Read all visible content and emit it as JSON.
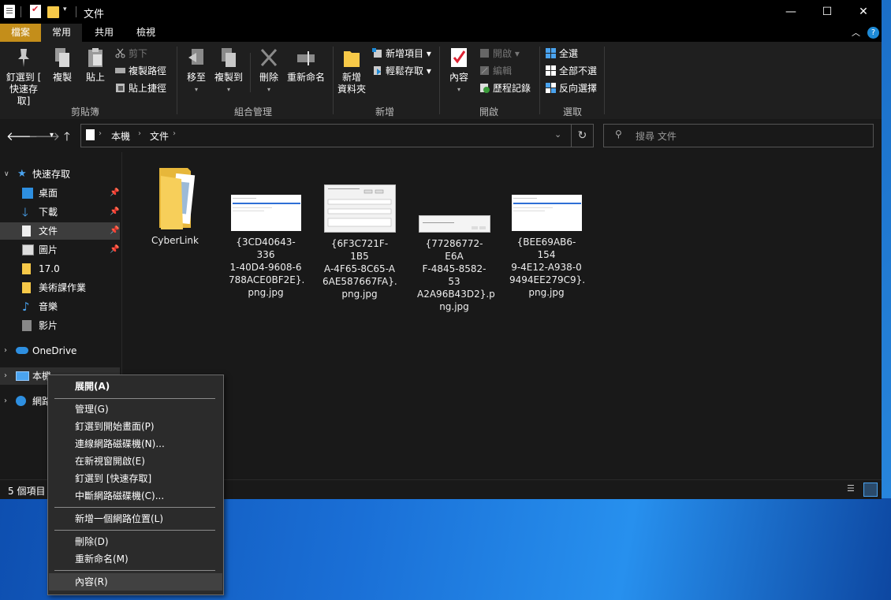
{
  "window": {
    "title": "文件",
    "controls": [
      "—",
      "☐",
      "✕"
    ]
  },
  "ribbon_tabs": {
    "file": "檔案",
    "home": "常用",
    "share": "共用",
    "view": "檢視",
    "help": "?"
  },
  "ribbon": {
    "clipboard": {
      "pin_line1": "釘選到 [",
      "pin_line2": "快速存取]",
      "copy": "複製",
      "paste": "貼上",
      "cut": "剪下",
      "copy_path": "複製路徑",
      "paste_shortcut": "貼上捷徑",
      "label": "剪貼簿"
    },
    "organize": {
      "move_to": "移至",
      "copy_to": "複製到",
      "delete": "刪除",
      "rename": "重新命名",
      "label": "組合管理"
    },
    "new": {
      "new_folder_line1": "新增",
      "new_folder_line2": "資料夾",
      "new_item": "新增項目",
      "easy_access": "輕鬆存取",
      "label": "新增"
    },
    "open": {
      "properties": "內容",
      "open": "開啟",
      "edit": "編輯",
      "history": "歷程記錄",
      "label": "開啟"
    },
    "select": {
      "select_all": "全選",
      "select_none": "全部不選",
      "invert": "反向選擇",
      "label": "選取"
    }
  },
  "address": {
    "crumbs": [
      "本機",
      "文件"
    ],
    "search_placeholder": "搜尋 文件"
  },
  "nav_pane": {
    "quick_access": "快速存取",
    "items": [
      "桌面",
      "下載",
      "文件",
      "圖片",
      "17.0",
      "美術課作業",
      "音樂",
      "影片"
    ],
    "onedrive": "OneDrive",
    "this_pc": "本機",
    "network": "網路"
  },
  "files": [
    {
      "name": "CyberLink"
    },
    {
      "name_lines": [
        "{3CD40643-336",
        "1-40D4-9608-6",
        "788ACE0BF2E}.",
        "png.jpg"
      ]
    },
    {
      "name_lines": [
        "{6F3C721F-1B5",
        "A-4F65-8C65-A",
        "6AE587667FA}.",
        "png.jpg"
      ]
    },
    {
      "name_lines": [
        "{77286772-E6A",
        "F-4845-8582-53",
        "A2A96B43D2}.p",
        "ng.jpg"
      ]
    },
    {
      "name_lines": [
        "{BEE69AB6-154",
        "9-4E12-A938-0",
        "9494EE279C9}.",
        "png.jpg"
      ]
    }
  ],
  "status": {
    "count": "5 個項目"
  },
  "context_menu": {
    "items": [
      "展開(A)",
      "管理(G)",
      "釘選到開始畫面(P)",
      "連線網路磁碟機(N)...",
      "在新視窗開啟(E)",
      "釘選到 [快速存取]",
      "中斷網路磁碟機(C)...",
      "新增一個網路位置(L)",
      "刪除(D)",
      "重新命名(M)",
      "內容(R)"
    ]
  },
  "colors": {
    "accent": "#1e8ad6",
    "file_tab": "#c48e1a",
    "folder": "#f7c948"
  }
}
